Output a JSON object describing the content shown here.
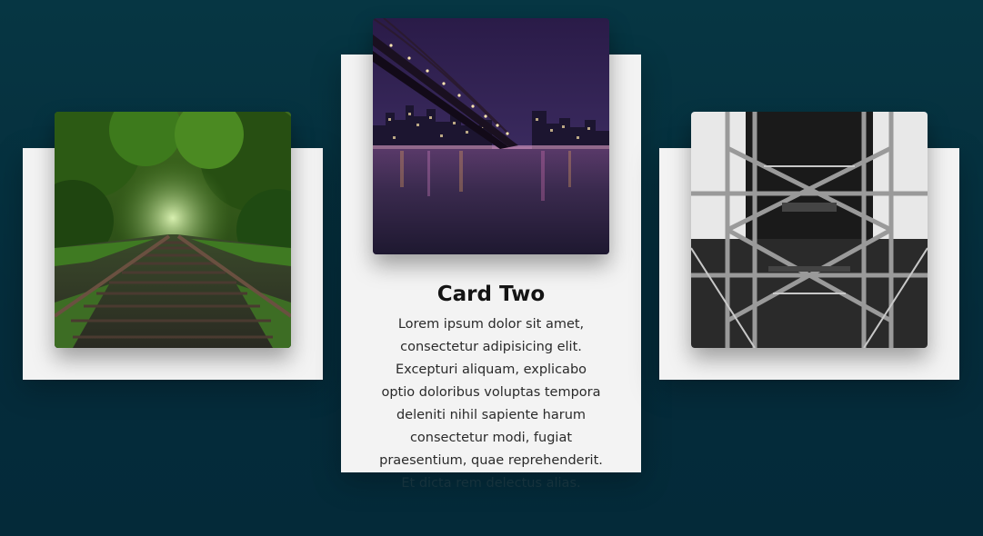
{
  "cards": [
    {
      "image": "railway-tracks-forest-photo"
    },
    {
      "image": "bridge-city-night-photo",
      "title": "Card Two",
      "description_lines": [
        "Lorem ipsum dolor sit amet,",
        "consectetur adipisicing elit.",
        "Excepturi aliquam, explicabo",
        "optio doloribus voluptas tempora",
        "deleniti nihil sapiente harum",
        "consectetur modi, fugiat",
        "praesentium, quae reprehenderit.",
        "Et dicta rem delectus alias."
      ]
    },
    {
      "image": "steel-bridge-tower-bw-photo"
    }
  ],
  "colors": {
    "background": "#063643",
    "card": "#f3f3f3",
    "title": "#141414",
    "text": "#2a2a2a"
  }
}
